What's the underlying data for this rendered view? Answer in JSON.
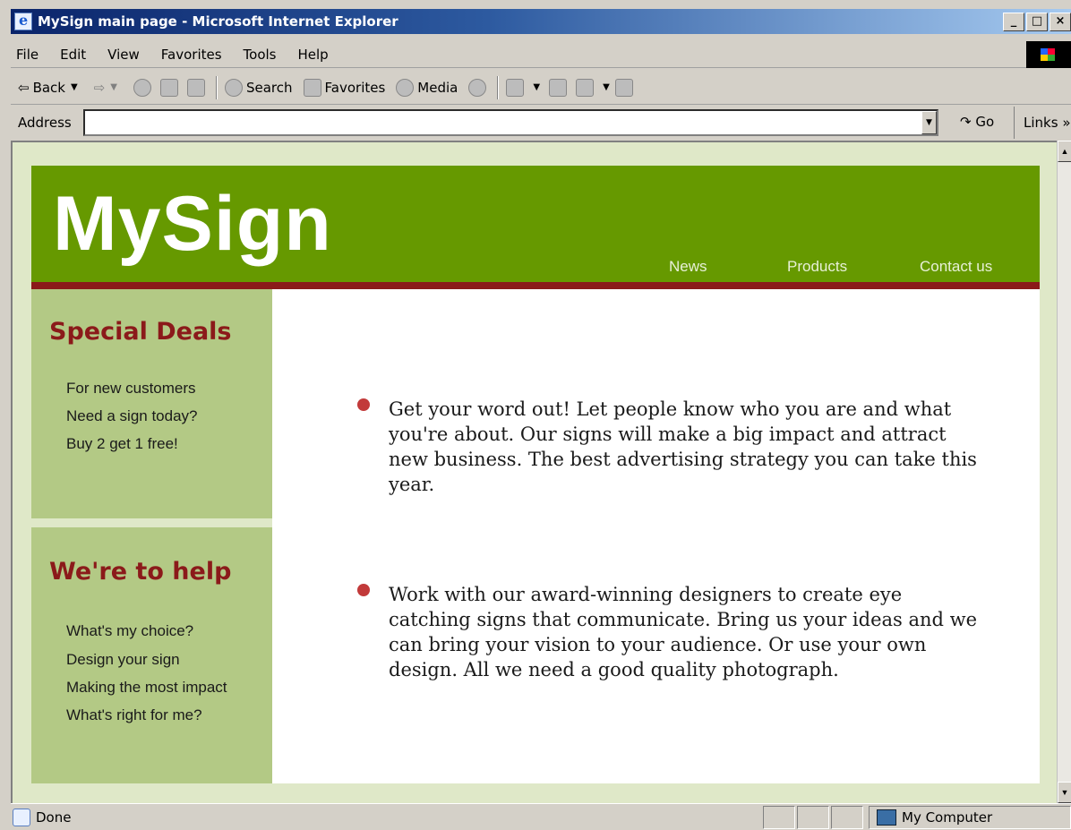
{
  "window": {
    "title": "MySign main page - Microsoft Internet Explorer",
    "min_label": "_",
    "max_label": "□",
    "close_label": "×"
  },
  "menu": {
    "file": "File",
    "edit": "Edit",
    "view": "View",
    "favorites": "Favorites",
    "tools": "Tools",
    "help": "Help"
  },
  "toolbar": {
    "back": "Back",
    "search": "Search",
    "favorites": "Favorites",
    "media": "Media"
  },
  "address": {
    "label": "Address",
    "value": "",
    "go": "Go",
    "links": "Links"
  },
  "site": {
    "logo": "MySign",
    "nav": [
      "News",
      "Products",
      "Contact us"
    ],
    "special_deals": {
      "title": "Special Deals",
      "links": [
        "For new customers",
        "Need a sign today?",
        "Buy 2 get 1 free!"
      ]
    },
    "help": {
      "title": "We're to help",
      "links": [
        "What's my choice?",
        "Design your sign",
        "Making the most impact",
        "What's right for me?"
      ]
    },
    "paragraphs": [
      "Get your word out! Let people know who you are and what you're about. Our signs will make a big impact and attract new business. The best advertising strategy you can take this year.",
      "Work with our award-winning designers to create eye catching signs that communicate. Bring us your ideas and we can bring your vision to your audience. Or use your own design. All we need a good quality photograph."
    ],
    "colors": {
      "header_green": "#669900",
      "accent_red": "#8b1a1a",
      "sidebar_green": "#b3c985",
      "bullet_red": "#c23a3a"
    }
  },
  "status": {
    "text": "Done",
    "zone": "My Computer"
  },
  "icons": {
    "ie": "ie-icon",
    "windows_logo": "windows-logo-icon",
    "stop": "stop-icon",
    "refresh": "refresh-icon",
    "home": "home-icon",
    "history": "history-icon",
    "mail": "mail-icon",
    "print": "print-icon",
    "edit": "edit-icon",
    "discuss": "discuss-icon",
    "computer": "computer-icon"
  }
}
